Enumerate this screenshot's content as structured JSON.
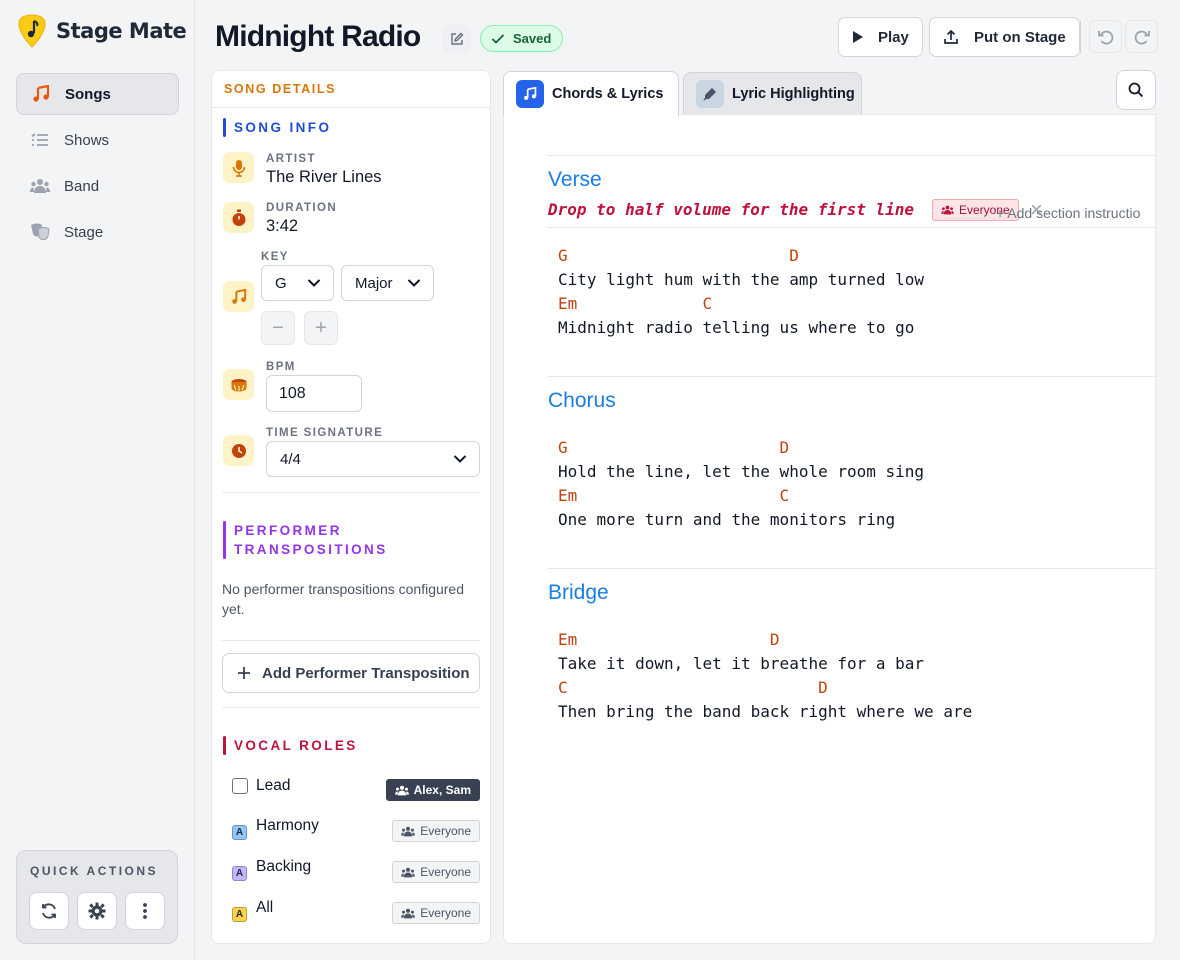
{
  "app": {
    "name": "Stage Mate",
    "brand_color": "#facc15"
  },
  "sidebar": {
    "items": [
      {
        "label": "Songs",
        "icon": "music-note-icon",
        "active": true
      },
      {
        "label": "Shows",
        "icon": "list-icon",
        "active": false
      },
      {
        "label": "Band",
        "icon": "users-icon",
        "active": false
      },
      {
        "label": "Stage",
        "icon": "theater-masks-icon",
        "active": false
      }
    ],
    "quick_actions": {
      "title": "QUICK ACTIONS",
      "buttons": [
        "refresh-icon",
        "gear-icon",
        "more-vertical-icon"
      ]
    }
  },
  "header": {
    "title": "Midnight Radio",
    "saved_label": "Saved",
    "play_label": "Play",
    "stage_label": "Put on Stage"
  },
  "details": {
    "heading": "SONG DETAILS",
    "song_info": {
      "heading": "SONG INFO",
      "artist_label": "ARTIST",
      "artist": "The River Lines",
      "duration_label": "DURATION",
      "duration": "3:42",
      "key_label": "KEY",
      "key": "G",
      "mode": "Major",
      "bpm_label": "BPM",
      "bpm": "108",
      "time_sig_label": "TIME SIGNATURE",
      "time_sig": "4/4"
    },
    "performer": {
      "heading": "PERFORMER TRANSPOSITIONS",
      "empty_text": "No performer transpositions configured yet.",
      "add_label": "Add Performer Transposition"
    },
    "vocal": {
      "heading": "VOCAL ROLES",
      "roles": [
        {
          "name": "Lead",
          "assigned": "Alex, Sam",
          "badge": "",
          "badge_color": ""
        },
        {
          "name": "Harmony",
          "assigned": "Everyone",
          "badge": "A",
          "badge_color": "#93c5fd"
        },
        {
          "name": "Backing",
          "assigned": "Everyone",
          "badge": "A",
          "badge_color": "#c4b5fd"
        },
        {
          "name": "All",
          "assigned": "Everyone",
          "badge": "A",
          "badge_color": "#fcd34d"
        }
      ]
    }
  },
  "editor": {
    "tabs": [
      {
        "label": "Chords & Lyrics",
        "active": true
      },
      {
        "label": "Lyric Highlighting",
        "active": false
      }
    ],
    "sections": [
      {
        "title": "Verse",
        "instruction": "Drop to half volume for the first line",
        "instruction_target": "Everyone",
        "add_instruction": "+ Add section instructio",
        "lines": [
          "G                       D",
          "City light hum with the amp turned low",
          "Em             C",
          "Midnight radio telling us where to go"
        ]
      },
      {
        "title": "Chorus",
        "lines": [
          "G                      D",
          "Hold the line, let the whole room sing",
          "Em                     C",
          "One more turn and the monitors ring"
        ]
      },
      {
        "title": "Bridge",
        "lines": [
          "Em                    D",
          "Take it down, let it breathe for a bar",
          "C                          D",
          "Then bring the band back right where we are"
        ]
      }
    ]
  }
}
